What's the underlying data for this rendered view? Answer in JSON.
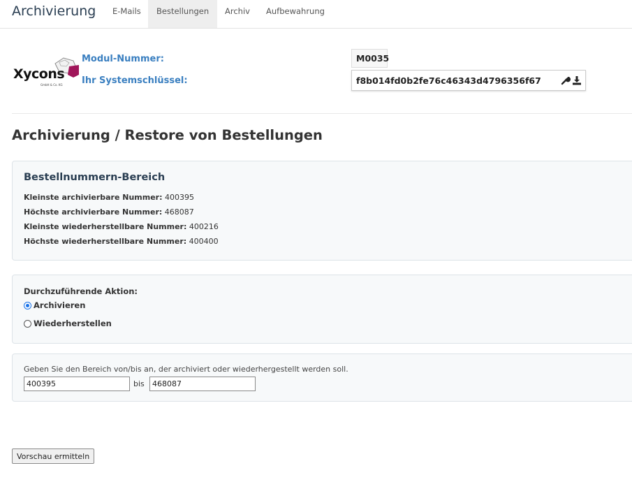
{
  "nav": {
    "brand": "Archivierung",
    "tabs": [
      "E-Mails",
      "Bestellungen",
      "Archiv",
      "Aufbewahrung"
    ],
    "active_tab": "Bestellungen"
  },
  "module": {
    "logo_text": "Xycons",
    "logo_sub": "GmbH & Co. KG",
    "number_label": "Modul-Nummer:",
    "number_value": "M0035",
    "key_label": "Ihr Systemschlüssel:",
    "key_value": "f8b014fd0b2fe76c46343d4796356f67",
    "icons": [
      "wrench-icon",
      "download-icon"
    ]
  },
  "page_title": "Archivierung / Restore von Bestellungen",
  "range_info": {
    "title": "Bestellnummern-Bereich",
    "rows": [
      {
        "label": "Kleinste archivierbare Nummer:",
        "value": "400395"
      },
      {
        "label": "Höchste archivierbare Nummer:",
        "value": "468087"
      },
      {
        "label": "Kleinste wiederherstellbare Nummer:",
        "value": "400216"
      },
      {
        "label": "Höchste wiederherstellbare Nummer:",
        "value": "400400"
      }
    ]
  },
  "action": {
    "title": "Durchzuführende Aktion:",
    "options": [
      "Archivieren",
      "Wiederherstellen"
    ],
    "selected": "Archivieren"
  },
  "range_input": {
    "instruction": "Geben Sie den Bereich von/bis an, der archiviert oder wiederhergestellt werden soll.",
    "from_value": "400395",
    "separator": "bis",
    "to_value": "468087"
  },
  "preview_button": "Vorschau ermitteln",
  "colors": {
    "accent_blue": "#3a7fc0",
    "title_dark": "#2a3e52",
    "logo_magenta": "#a0165a",
    "radio_blue": "#1a73e8"
  }
}
